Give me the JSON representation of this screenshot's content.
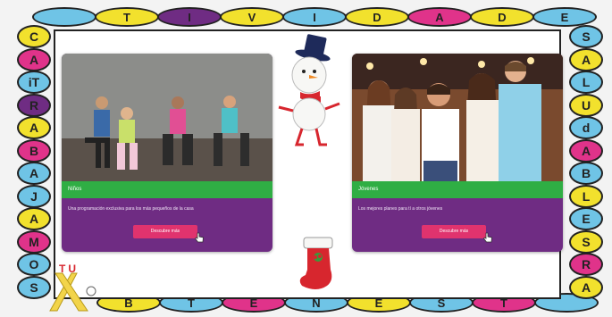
{
  "frame": {
    "top_letters": [
      "T",
      "I",
      "V",
      "I",
      "D",
      "A",
      "D",
      "E"
    ],
    "top_colors": [
      "#6fc4e6",
      "#f2e12d",
      "#6f2c83",
      "#f2e12d",
      "#6fc4e6",
      "#f2e12d",
      "#e0338a",
      "#f2e12d",
      "#6fc4e6"
    ],
    "left_letters": [
      "C",
      "A",
      "iT",
      "R",
      "A",
      "B",
      "A",
      "J",
      "A",
      "M",
      "O",
      "S"
    ],
    "left_colors": [
      "#f2e12d",
      "#e0338a",
      "#6fc4e6",
      "#6f2c83",
      "#f2e12d",
      "#e0338a",
      "#6fc4e6",
      "#6fc4e6",
      "#f2e12d",
      "#e0338a",
      "#6fc4e6",
      "#6fc4e6"
    ],
    "right_letters": [
      "S",
      "A",
      "L",
      "U",
      "d",
      "A",
      "B",
      "L",
      "E",
      "S",
      "R",
      "A"
    ],
    "right_colors": [
      "#6fc4e6",
      "#f2e12d",
      "#6fc4e6",
      "#f2e12d",
      "#6fc4e6",
      "#e0338a",
      "#6fc4e6",
      "#f2e12d",
      "#6fc4e6",
      "#f2e12d",
      "#e0338a",
      "#f2e12d"
    ],
    "bottom_letters": [
      "B",
      "T",
      "E",
      "N",
      "E",
      "S",
      "T"
    ],
    "bottom_colors": [
      "#f2e12d",
      "#6fc4e6",
      "#e0338a",
      "#6fc4e6",
      "#f2e12d",
      "#6fc4e6",
      "#e0338a",
      "#6fc4e6"
    ],
    "logo_letters": "TU"
  },
  "cards": [
    {
      "title": "Niños",
      "description": "Una programación exclusiva para los más pequeños de la casa",
      "button": "Descubre más"
    },
    {
      "title": "Jóvenes",
      "description": "Los mejores planes para tí a otros jóvenes",
      "button": "Descubre más"
    }
  ],
  "colors": {
    "card_bg": "#6f2c83",
    "band_green": "#2fae44",
    "button_pink": "#e0336e"
  },
  "icons": [
    "snowman-icon",
    "christmas-stocking-icon",
    "hand-cursor-icon",
    "logo-x-icon"
  ]
}
